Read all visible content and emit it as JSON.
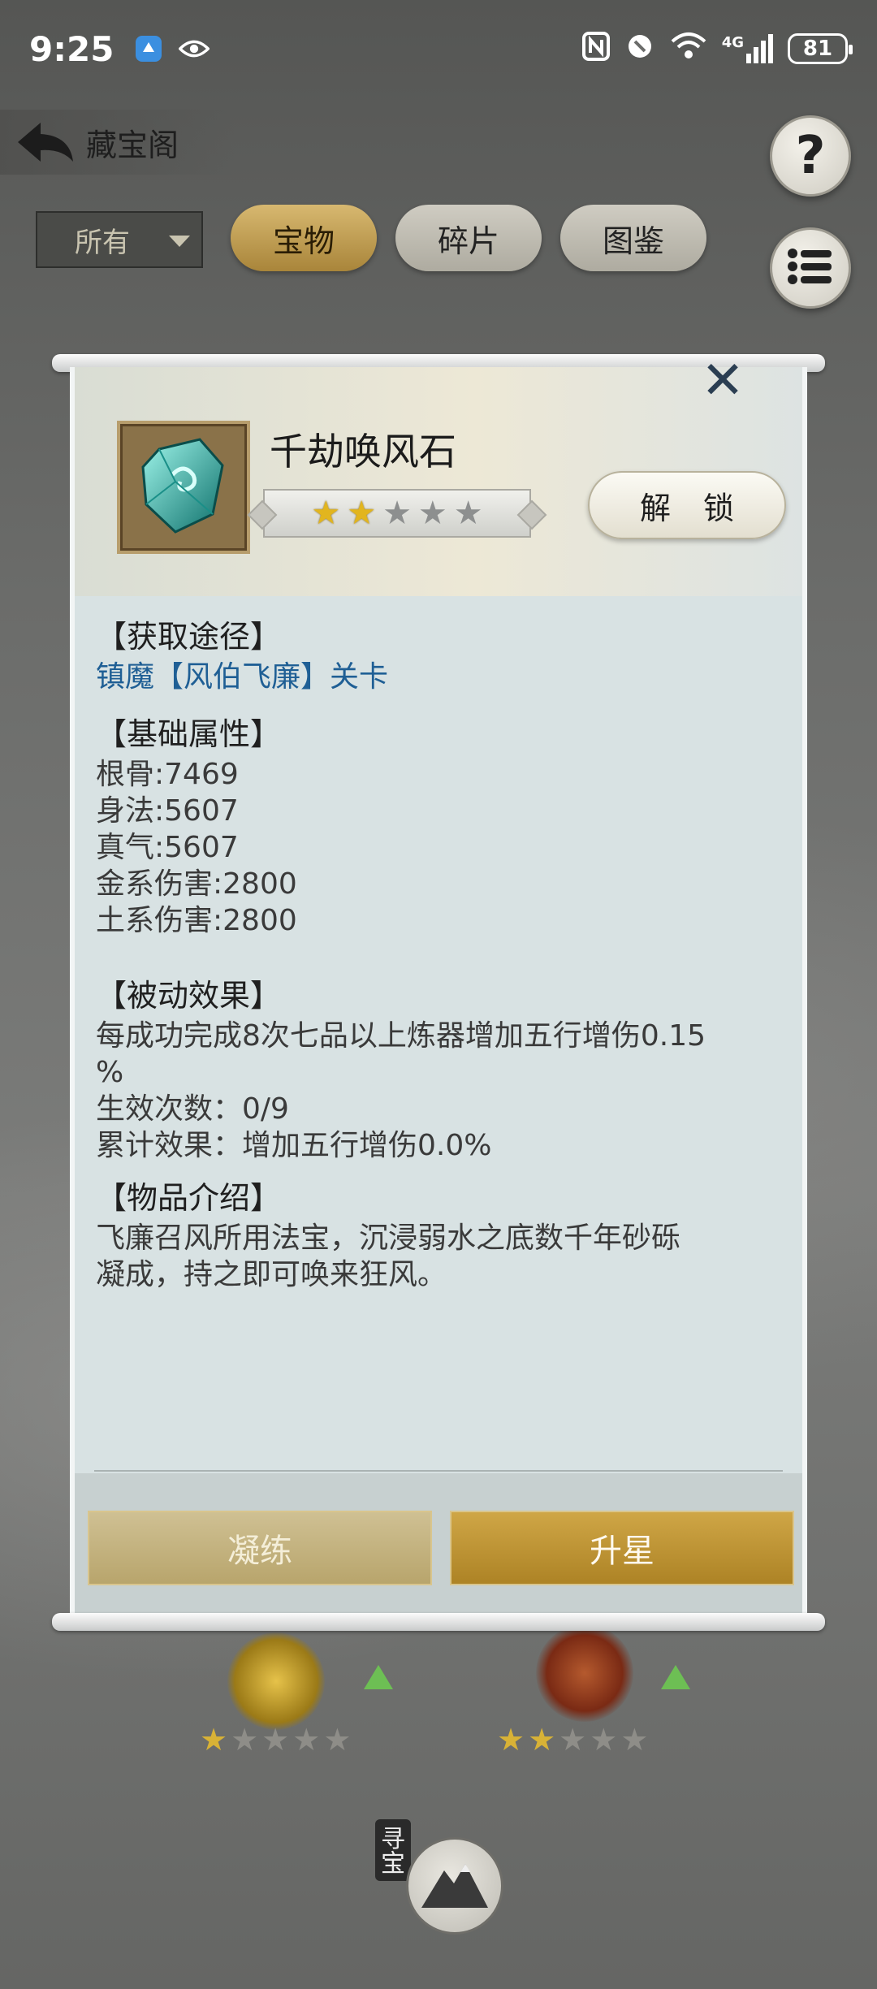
{
  "status_bar": {
    "time": "9:25",
    "battery": "81",
    "network": "4G"
  },
  "header": {
    "title": "藏宝阁",
    "filter_value": "所有",
    "tabs": [
      "宝物",
      "碎片",
      "图鉴"
    ]
  },
  "background": {
    "hunt_label": "寻宝",
    "item_1_stars": 1,
    "item_2_stars": 2,
    "max_stars": 5
  },
  "item": {
    "name": "千劫唤风石",
    "stars": 2,
    "max_stars": 5,
    "unlock_label": "解 锁",
    "sections": {
      "source_title": "【获取途径】",
      "source_text": "镇魔【风伯飞廉】关卡",
      "attr_title": "【基础属性】",
      "attrs": [
        "根骨:7469",
        "身法:5607",
        "真气:5607",
        "金系伤害:2800",
        "土系伤害:2800"
      ],
      "passive_title": "【被动效果】",
      "passive_line1": "每成功完成8次七品以上炼器增加五行增伤0.15",
      "passive_line2": "%",
      "passive_count": "生效次数：0/9",
      "passive_total": "累计效果：增加五行增伤0.0%",
      "intro_title": "【物品介绍】",
      "intro_line1": "飞廉召风所用法宝，沉浸弱水之底数千年砂砾",
      "intro_line2": "凝成，持之即可唤来狂风。"
    }
  },
  "footer": {
    "refine_label": "凝练",
    "upgrade_label": "升星"
  },
  "colors": {
    "link": "#1f5f95",
    "gold_button": "#ad8325",
    "star_on": "#e2b51e",
    "star_off": "#8d8f8f"
  }
}
